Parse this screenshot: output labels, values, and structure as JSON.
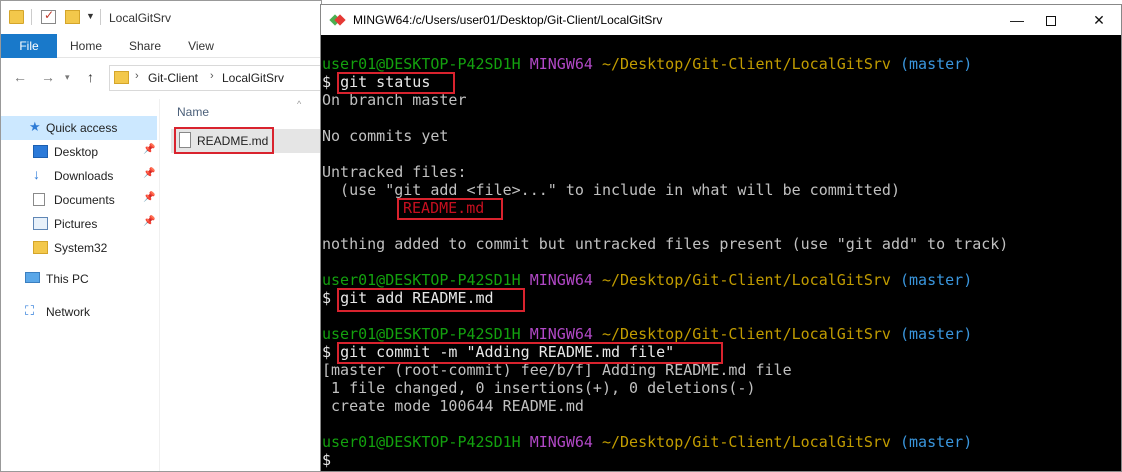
{
  "explorer": {
    "title": "LocalGitSrv",
    "ribbon_tabs": [
      "File",
      "Home",
      "Share",
      "View"
    ],
    "address": [
      "Git-Client",
      "LocalGitSrv"
    ],
    "nav": {
      "quick_access": "Quick access",
      "desktop": "Desktop",
      "downloads": "Downloads",
      "documents": "Documents",
      "pictures": "Pictures",
      "system32": "System32",
      "this_pc": "This PC",
      "network": "Network"
    },
    "column_name": "Name",
    "files": [
      "README.md"
    ]
  },
  "terminal": {
    "title": "MINGW64:/c/Users/user01/Desktop/Git-Client/LocalGitSrv",
    "prompt": {
      "user_host": "user01@DESKTOP-P42SD1H",
      "shell": "MINGW64",
      "path": "~/Desktop/Git-Client/LocalGitSrv",
      "branch": "(master)",
      "symbol": "$"
    },
    "commands": {
      "status": "git status",
      "add": "git add README.md",
      "commit": "git commit -m \"Adding README.md file\""
    },
    "output": {
      "on_branch": "On branch master",
      "no_commits": "No commits yet",
      "untracked": "Untracked files:",
      "hint": "  (use \"git add <file>...\" to include in what will be committed)",
      "untracked_file": "README.md",
      "nothing_added": "nothing added to commit but untracked files present (use \"git add\" to track)",
      "commit_result": "[master (root-commit) fee/b/f] Adding README.md file",
      "changed": " 1 file changed, 0 insertions(+), 0 deletions(-)",
      "create_mode": " create mode 100644 README.md"
    }
  },
  "colors": {
    "prompt_user": "#13a10e",
    "prompt_shell": "#b148c6",
    "prompt_path": "#c19c00",
    "prompt_branch": "#3a96dd",
    "untracked_file": "#c50f1f",
    "highlight": "#d9232e",
    "file_tab": "#1979ca"
  }
}
